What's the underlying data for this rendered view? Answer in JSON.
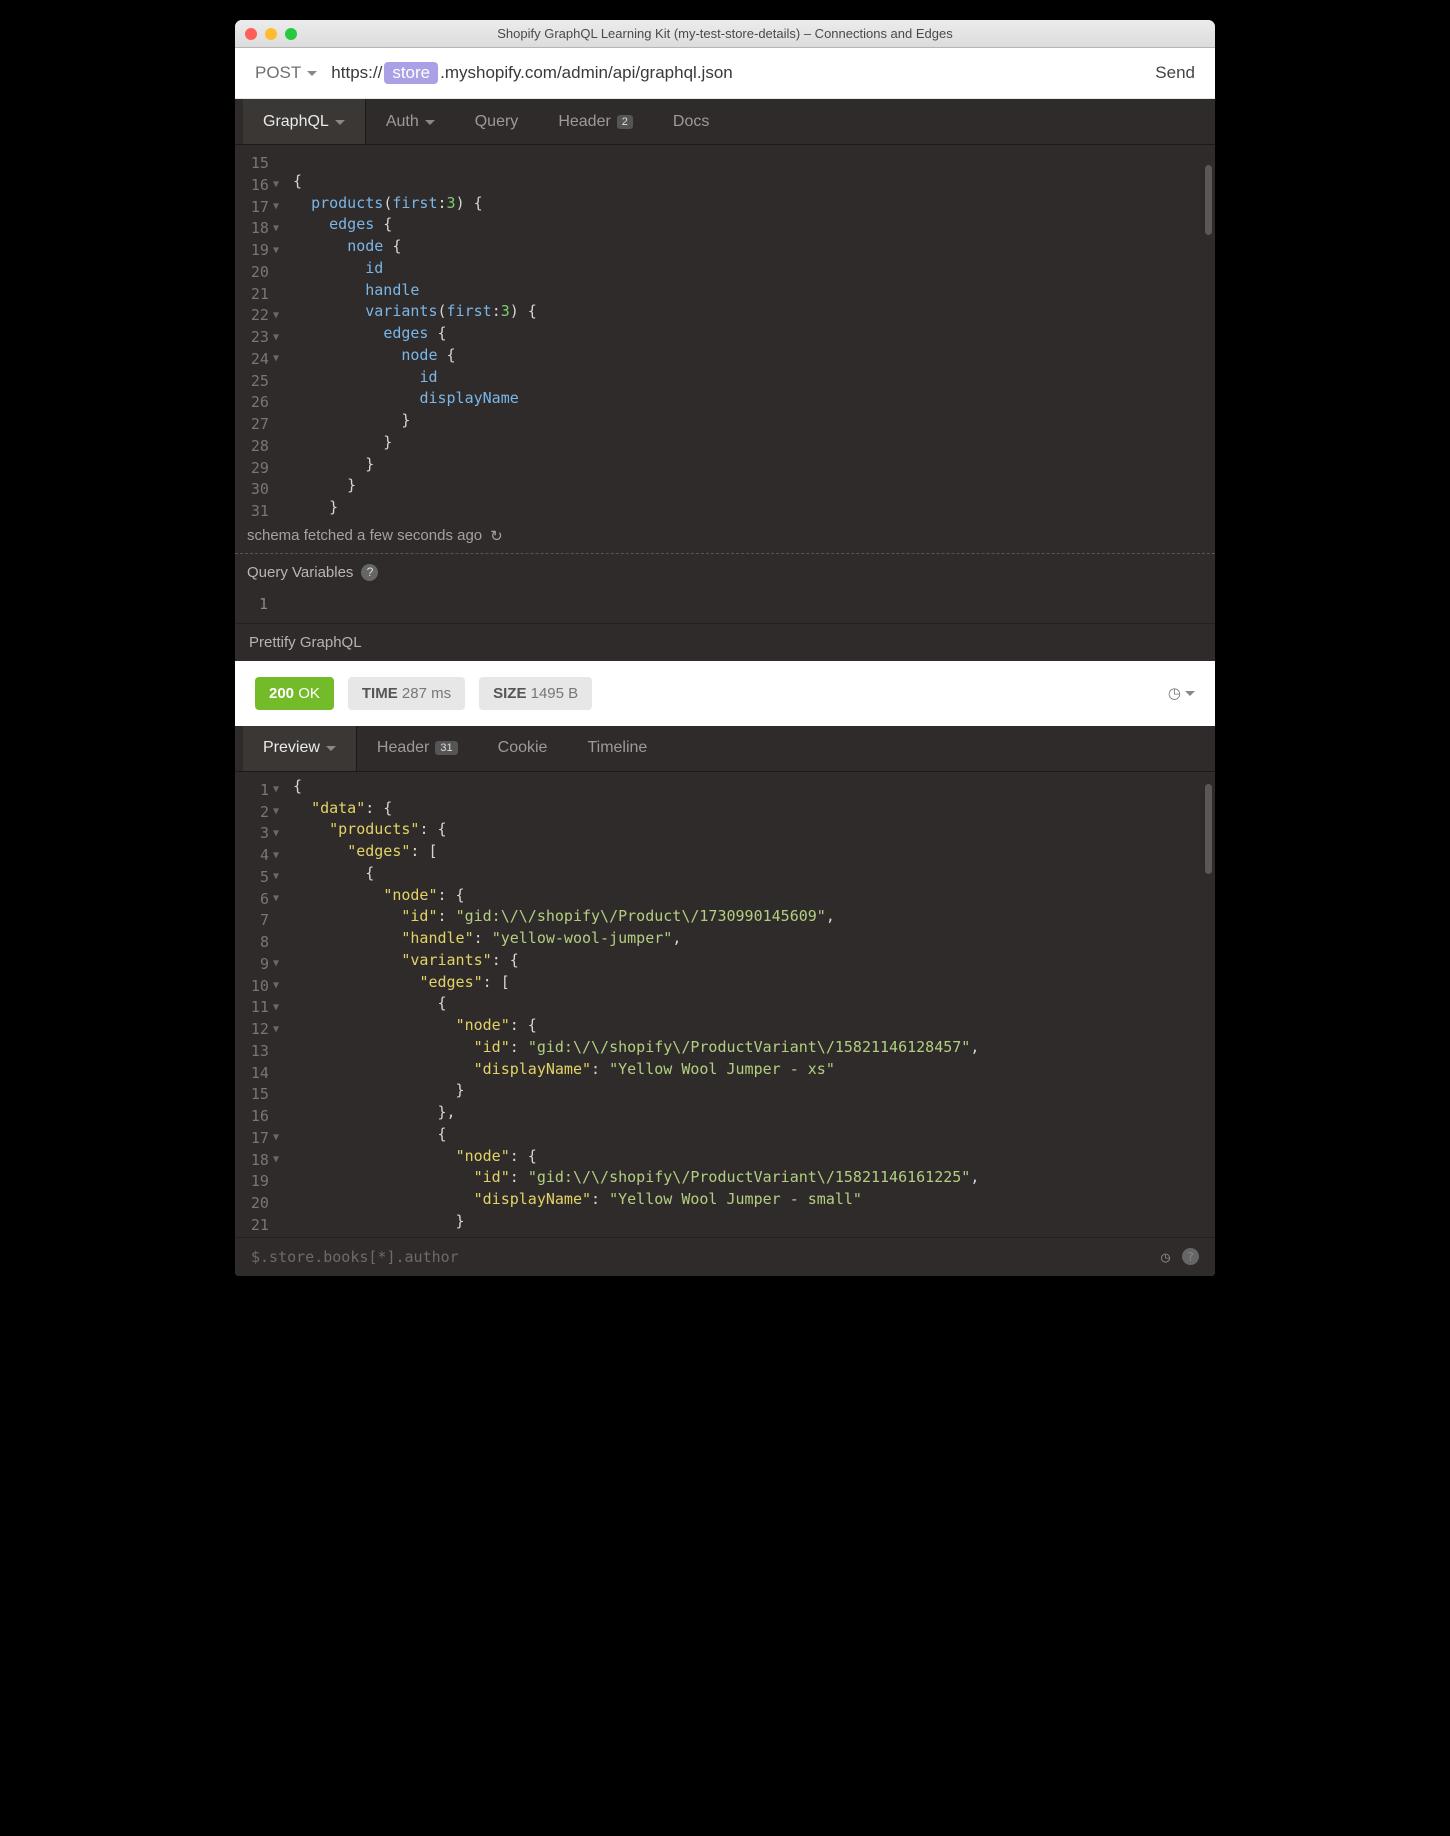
{
  "title": "Shopify GraphQL Learning Kit (my-test-store-details) – Connections and Edges",
  "request": {
    "method": "POST",
    "url_prefix": "https://",
    "url_tag": "store",
    "url_suffix": ".myshopify.com/admin/api/graphql.json",
    "send": "Send"
  },
  "req_tabs": {
    "graphql": "GraphQL",
    "auth": "Auth",
    "query": "Query",
    "header": "Header",
    "header_badge": "2",
    "docs": "Docs"
  },
  "editor_lines": {
    "start": 15,
    "folds": [
      16,
      17,
      18,
      19,
      22,
      23,
      24
    ],
    "code": [
      "",
      "{",
      "  products(first:3) {",
      "    edges {",
      "      node {",
      "        id",
      "        handle",
      "        variants(first:3) {",
      "          edges {",
      "            node {",
      "              id",
      "              displayName",
      "            }",
      "          }",
      "        }",
      "      }",
      "    }"
    ]
  },
  "schema_status": "schema fetched a few seconds ago",
  "qv_label": "Query Variables",
  "qv_lineno": "1",
  "prettify": "Prettify GraphQL",
  "status": {
    "code": "200",
    "ok": "OK",
    "time_label": "TIME",
    "time_val": "287 ms",
    "size_label": "SIZE",
    "size_val": "1495 B"
  },
  "res_tabs": {
    "preview": "Preview",
    "header": "Header",
    "header_badge": "31",
    "cookie": "Cookie",
    "timeline": "Timeline"
  },
  "response_lines": {
    "folds": [
      1,
      2,
      3,
      4,
      5,
      6,
      9,
      10,
      11,
      12,
      17,
      18
    ],
    "rows": [
      {
        "n": 1,
        "t": "brace",
        "text": "{"
      },
      {
        "n": 2,
        "t": "kv",
        "indent": 1,
        "key": "data",
        "after": ": {"
      },
      {
        "n": 3,
        "t": "kv",
        "indent": 2,
        "key": "products",
        "after": ": {"
      },
      {
        "n": 4,
        "t": "kv",
        "indent": 3,
        "key": "edges",
        "after": ": ["
      },
      {
        "n": 5,
        "t": "brace",
        "indent": 4,
        "text": "{"
      },
      {
        "n": 6,
        "t": "kv",
        "indent": 5,
        "key": "node",
        "after": ": {"
      },
      {
        "n": 7,
        "t": "kvstr",
        "indent": 6,
        "key": "id",
        "val": "gid:\\/\\/shopify\\/Product\\/1730990145609",
        "comma": true
      },
      {
        "n": 8,
        "t": "kvstr",
        "indent": 6,
        "key": "handle",
        "val": "yellow-wool-jumper",
        "comma": true
      },
      {
        "n": 9,
        "t": "kv",
        "indent": 6,
        "key": "variants",
        "after": ": {"
      },
      {
        "n": 10,
        "t": "kv",
        "indent": 7,
        "key": "edges",
        "after": ": ["
      },
      {
        "n": 11,
        "t": "brace",
        "indent": 8,
        "text": "{"
      },
      {
        "n": 12,
        "t": "kv",
        "indent": 9,
        "key": "node",
        "after": ": {"
      },
      {
        "n": 13,
        "t": "kvstr",
        "indent": 10,
        "key": "id",
        "val": "gid:\\/\\/shopify\\/ProductVariant\\/15821146128457",
        "comma": true
      },
      {
        "n": 14,
        "t": "kvstr",
        "indent": 10,
        "key": "displayName",
        "val": "Yellow Wool Jumper - xs"
      },
      {
        "n": 15,
        "t": "brace",
        "indent": 9,
        "text": "}"
      },
      {
        "n": 16,
        "t": "brace",
        "indent": 8,
        "text": "},"
      },
      {
        "n": 17,
        "t": "brace",
        "indent": 8,
        "text": "{"
      },
      {
        "n": 18,
        "t": "kv",
        "indent": 9,
        "key": "node",
        "after": ": {"
      },
      {
        "n": 19,
        "t": "kvstr",
        "indent": 10,
        "key": "id",
        "val": "gid:\\/\\/shopify\\/ProductVariant\\/15821146161225",
        "comma": true
      },
      {
        "n": 20,
        "t": "kvstr",
        "indent": 10,
        "key": "displayName",
        "val": "Yellow Wool Jumper - small"
      },
      {
        "n": 21,
        "t": "brace",
        "indent": 9,
        "text": "}"
      }
    ]
  },
  "footer_placeholder": "$.store.books[*].author"
}
